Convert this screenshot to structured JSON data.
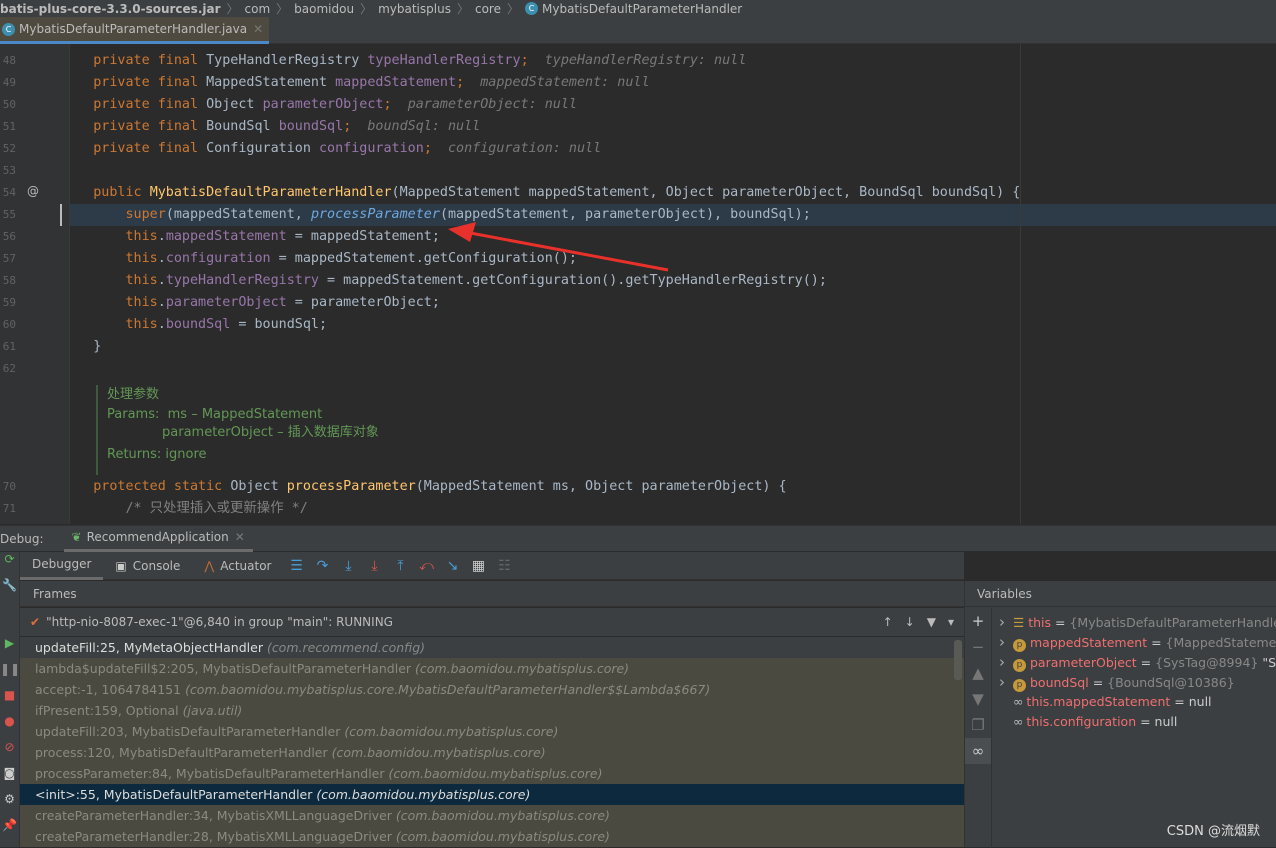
{
  "breadcrumb": [
    "batis-plus-core-3.3.0-sources.jar",
    "com",
    "baomidou",
    "mybatisplus",
    "core",
    "MybatisDefaultParameterHandler"
  ],
  "editor_tab": {
    "label": "MybatisDefaultParameterHandler.java"
  },
  "code_lines": [
    {
      "n": "48",
      "t": [
        [
          "    private final ",
          "kw"
        ],
        [
          "TypeHandlerRegistry ",
          "tp"
        ],
        [
          "typeHandlerRegistry",
          "fd"
        ],
        [
          ";  ",
          "kw"
        ],
        [
          "typeHandlerRegistry: null",
          "hint"
        ]
      ]
    },
    {
      "n": "49",
      "t": [
        [
          "    private final ",
          "kw"
        ],
        [
          "MappedStatement ",
          "tp"
        ],
        [
          "mappedStatement",
          "fd"
        ],
        [
          ";  ",
          "kw"
        ],
        [
          "mappedStatement: null",
          "hint"
        ]
      ]
    },
    {
      "n": "50",
      "t": [
        [
          "    private final ",
          "kw"
        ],
        [
          "Object ",
          "tp"
        ],
        [
          "parameterObject",
          "fd"
        ],
        [
          ";  ",
          "kw"
        ],
        [
          "parameterObject: null",
          "hint"
        ]
      ]
    },
    {
      "n": "51",
      "t": [
        [
          "    private final ",
          "kw"
        ],
        [
          "BoundSql ",
          "tp"
        ],
        [
          "boundSql",
          "fd"
        ],
        [
          ";  ",
          "kw"
        ],
        [
          "boundSql: null",
          "hint"
        ]
      ]
    },
    {
      "n": "52",
      "t": [
        [
          "    private final ",
          "kw"
        ],
        [
          "Configuration ",
          "tp"
        ],
        [
          "configuration",
          "fd"
        ],
        [
          ";  ",
          "kw"
        ],
        [
          "configuration: null",
          "hint"
        ]
      ]
    },
    {
      "n": "53",
      "t": []
    },
    {
      "n": "54",
      "t": [
        [
          "    public ",
          "kw"
        ],
        [
          "MybatisDefaultParameterHandler",
          "mt"
        ],
        [
          "(MappedStatement mappedStatement, Object parameterObject, BoundSql boundSql) {",
          "tp"
        ]
      ]
    },
    {
      "n": "55",
      "t": [
        [
          "        super",
          "kw"
        ],
        [
          "(mappedStatement, ",
          "tp"
        ],
        [
          "processParameter",
          "st"
        ],
        [
          "(mappedStatement, parameterObject), boundSql);",
          "tp"
        ]
      ]
    },
    {
      "n": "56",
      "t": [
        [
          "        this",
          "kw"
        ],
        [
          ".",
          "tp"
        ],
        [
          "mappedStatement",
          "fd"
        ],
        [
          " = mappedStatement;",
          "tp"
        ]
      ]
    },
    {
      "n": "57",
      "t": [
        [
          "        this",
          "kw"
        ],
        [
          ".",
          "tp"
        ],
        [
          "configuration",
          "fd"
        ],
        [
          " = mappedStatement.getConfiguration();",
          "tp"
        ]
      ]
    },
    {
      "n": "58",
      "t": [
        [
          "        this",
          "kw"
        ],
        [
          ".",
          "tp"
        ],
        [
          "typeHandlerRegistry",
          "fd"
        ],
        [
          " = mappedStatement.getConfiguration().getTypeHandlerRegistry();",
          "tp"
        ]
      ]
    },
    {
      "n": "59",
      "t": [
        [
          "        this",
          "kw"
        ],
        [
          ".",
          "tp"
        ],
        [
          "parameterObject",
          "fd"
        ],
        [
          " = parameterObject;",
          "tp"
        ]
      ]
    },
    {
      "n": "60",
      "t": [
        [
          "        this",
          "kw"
        ],
        [
          ".",
          "tp"
        ],
        [
          "boundSql",
          "fd"
        ],
        [
          " = boundSql;",
          "tp"
        ]
      ]
    },
    {
      "n": "61",
      "t": [
        [
          "    }",
          "tp"
        ]
      ]
    },
    {
      "n": "62",
      "t": []
    }
  ],
  "doc": {
    "summary": "处理参数",
    "params_label": "Params:",
    "param1": "ms – MappedStatement",
    "param2": "parameterObject – 插入数据库对象",
    "returns": "Returns: ignore"
  },
  "code_lines2": [
    {
      "n": "70",
      "t": [
        [
          "    protected static ",
          "kw"
        ],
        [
          "Object ",
          "tp"
        ],
        [
          "processParameter",
          "mt"
        ],
        [
          "(MappedStatement ms, Object parameterObject) {",
          "tp"
        ]
      ]
    },
    {
      "n": "71",
      "t": [
        [
          "        /* 只处理插入或更新操作 */",
          "cm"
        ]
      ]
    }
  ],
  "debug": {
    "label": "Debug:",
    "app_tab": "RecommendApplication",
    "tabs": [
      "Debugger",
      "Console",
      "Actuator"
    ],
    "frames_header": "Frames",
    "thread": "\"http-nio-8087-exec-1\"@6,840 in group \"main\": RUNNING",
    "frames": [
      {
        "m": "updateFill:25, MyMetaObjectHandler ",
        "p": "(com.recommend.config)"
      },
      {
        "m": "lambda$updateFill$2:205, MybatisDefaultParameterHandler ",
        "p": "(com.baomidou.mybatisplus.core)"
      },
      {
        "m": "accept:-1, 1064784151 ",
        "p": "(com.baomidou.mybatisplus.core.MybatisDefaultParameterHandler$$Lambda$667)"
      },
      {
        "m": "ifPresent:159, Optional ",
        "p": "(java.util)"
      },
      {
        "m": "updateFill:203, MybatisDefaultParameterHandler ",
        "p": "(com.baomidou.mybatisplus.core)"
      },
      {
        "m": "process:120, MybatisDefaultParameterHandler ",
        "p": "(com.baomidou.mybatisplus.core)"
      },
      {
        "m": "processParameter:84, MybatisDefaultParameterHandler ",
        "p": "(com.baomidou.mybatisplus.core)"
      },
      {
        "m": "<init>:55, MybatisDefaultParameterHandler ",
        "p": "(com.baomidou.mybatisplus.core)"
      },
      {
        "m": "createParameterHandler:34, MybatisXMLLanguageDriver ",
        "p": "(com.baomidou.mybatisplus.core)"
      },
      {
        "m": "createParameterHandler:28, MybatisXMLLanguageDriver ",
        "p": "(com.baomidou.mybatisplus.core)"
      }
    ],
    "selected_frame": 7
  },
  "variables": {
    "header": "Variables",
    "items": [
      {
        "name": "this",
        "eq": " = ",
        "val": "{MybatisDefaultParameterHandler@",
        "icon": "object-icon"
      },
      {
        "name": "mappedStatement",
        "eq": " = ",
        "val": "{MappedStatement@",
        "icon": "parameter-icon"
      },
      {
        "name": "parameterObject",
        "eq": " = ",
        "val": "{SysTag@8994} ",
        "extra": "\"SysCo",
        "icon": "parameter-icon"
      },
      {
        "name": "boundSql",
        "eq": " = ",
        "val": "{BoundSql@10386}",
        "icon": "parameter-icon"
      },
      {
        "name": "this.mappedStatement",
        "eq": " = ",
        "w": "null",
        "icon": "watch-icon"
      },
      {
        "name": "this.configuration",
        "eq": " = ",
        "w": "null",
        "icon": "watch-icon"
      }
    ]
  },
  "watermark": "CSDN @流烟默"
}
